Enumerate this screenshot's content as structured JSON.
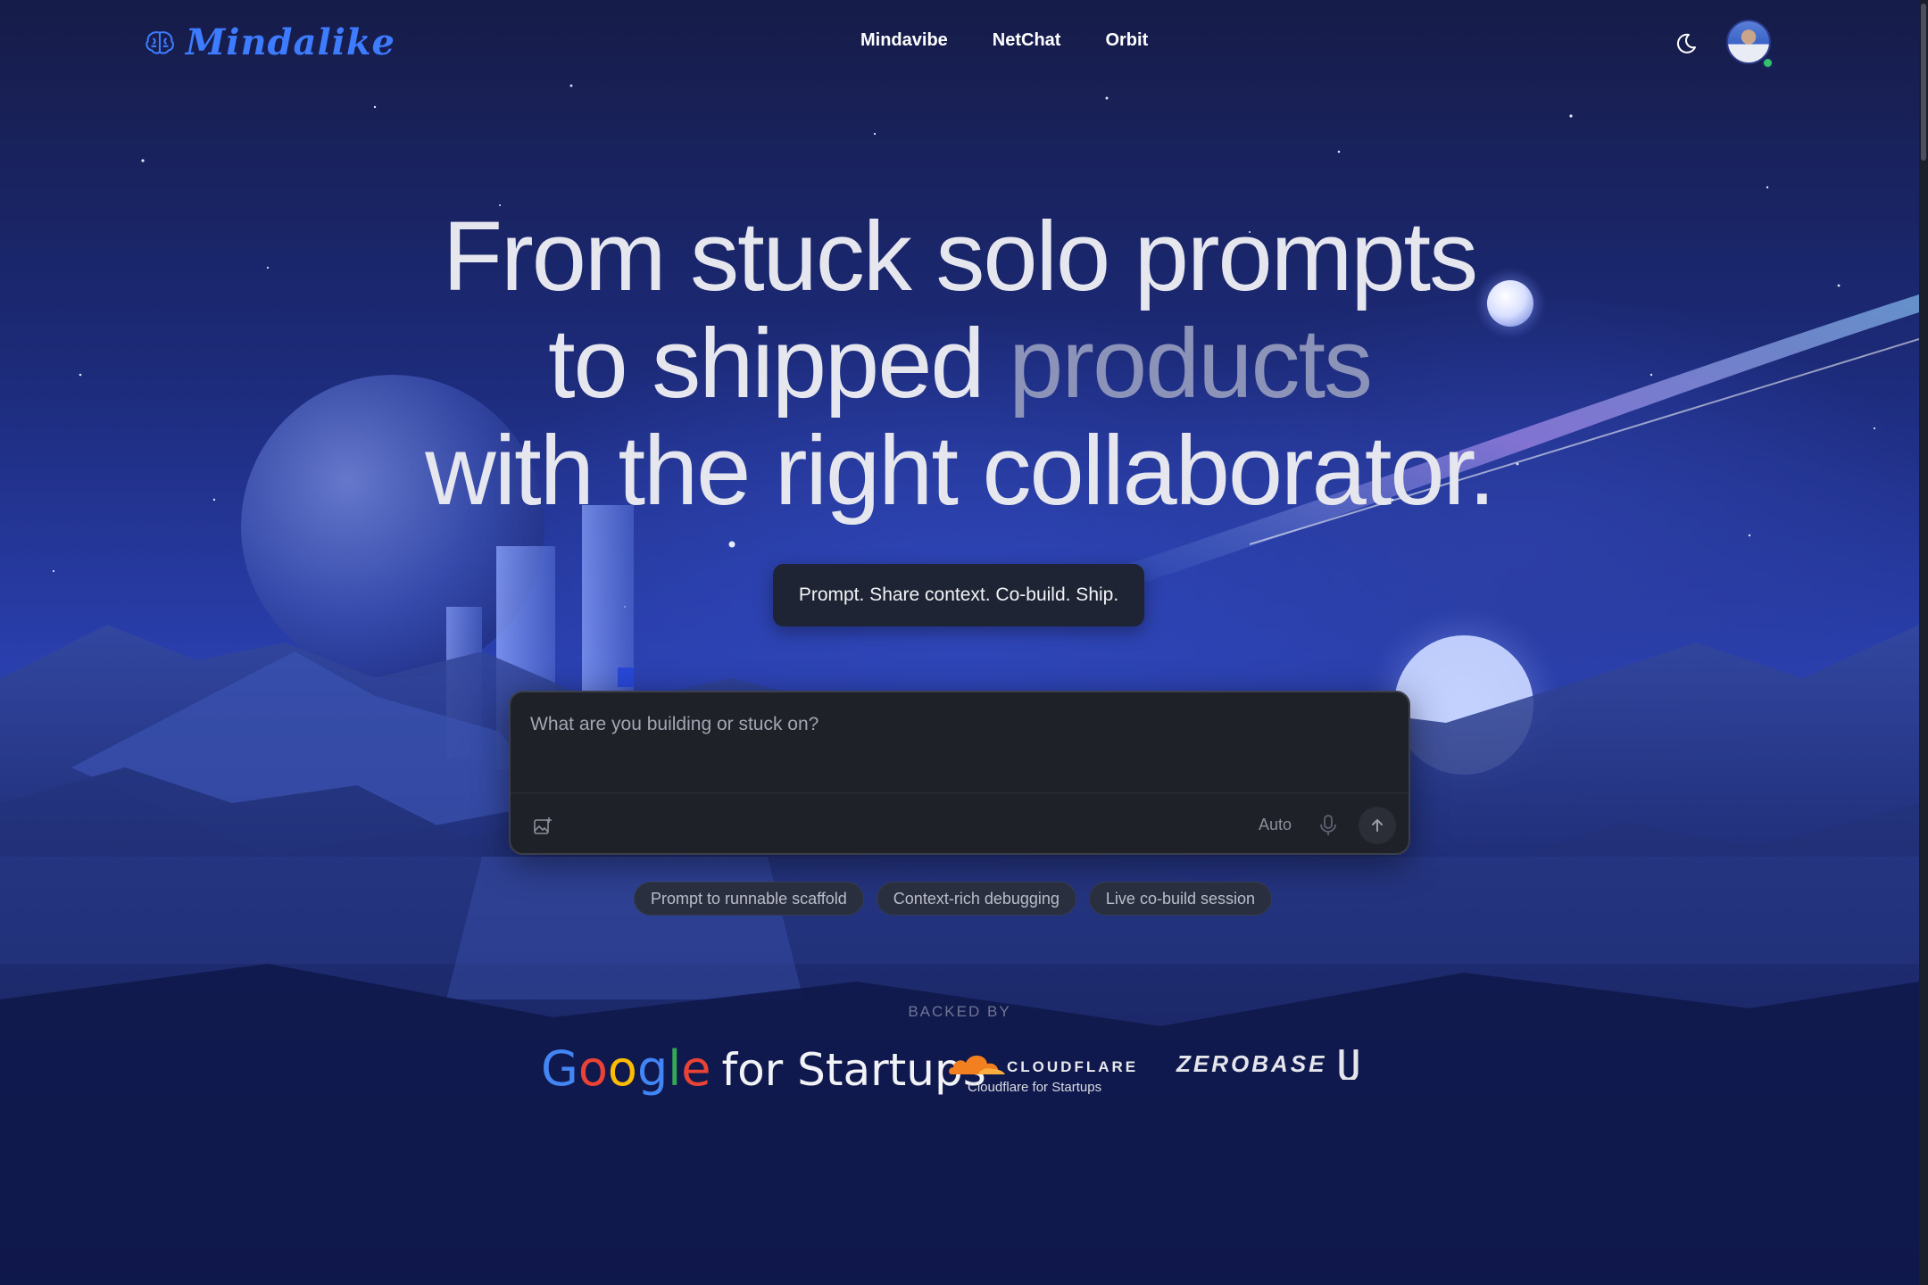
{
  "brand": {
    "name": "Mindalike",
    "color": "#3d7bff"
  },
  "nav": {
    "links": [
      {
        "label": "Mindavibe"
      },
      {
        "label": "NetChat"
      },
      {
        "label": "Orbit"
      }
    ],
    "theme_icon": "moon-icon",
    "avatar_status_color": "#33c26a"
  },
  "hero": {
    "line1": "From stuck solo prompts",
    "line2_a": "to shipped ",
    "line2_b": "products",
    "line3": "with the right collaborator."
  },
  "tagline": "Prompt. Share context. Co-build. Ship.",
  "composer": {
    "placeholder": "What are you building or stuck on?",
    "value": "",
    "mode_label": "Auto",
    "icons": [
      "image-add-icon",
      "microphone-icon",
      "arrow-up-icon"
    ]
  },
  "suggestions": [
    {
      "label": "Prompt to runnable scaffold"
    },
    {
      "label": "Context-rich debugging"
    },
    {
      "label": "Live co-build session"
    }
  ],
  "backers": {
    "heading": "BACKED BY",
    "google": {
      "g1": "G",
      "g2": "o",
      "g3": "o",
      "g4": "g",
      "g5": "l",
      "g6": "e",
      "suffix": "for Startups"
    },
    "cloudflare": {
      "name": "CLOUDFLARE",
      "sub": "Cloudflare for Startups",
      "color": "#f38020"
    },
    "zerobase": {
      "name": "ZEROBASE"
    }
  }
}
